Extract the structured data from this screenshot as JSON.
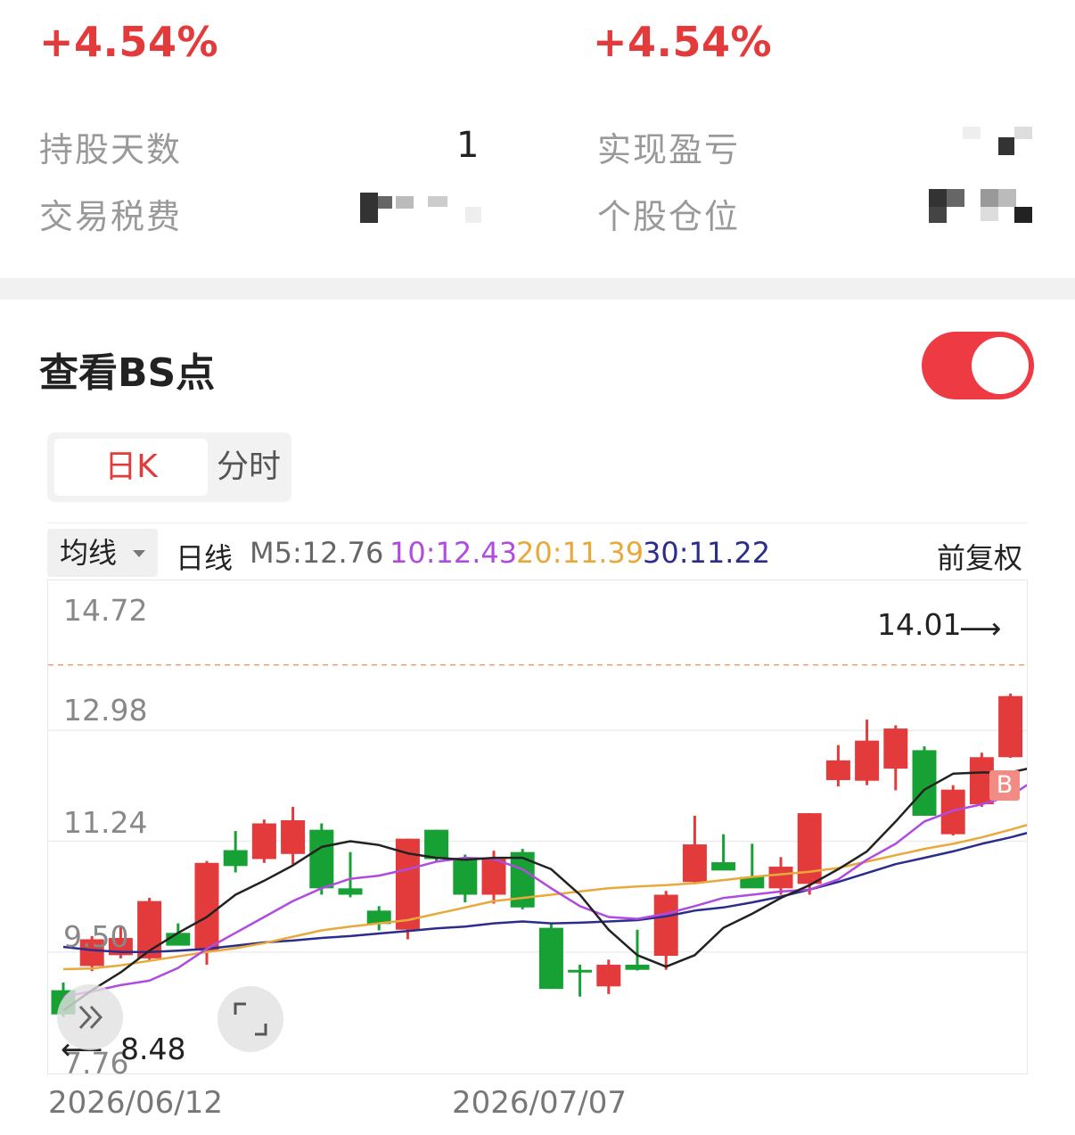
{
  "stats": {
    "pct_left": "+4.54%",
    "pct_right": "+4.54%",
    "hold_days_label": "持股天数",
    "hold_days_value": "1",
    "realized_pnl_label": "实现盈亏",
    "tax_fee_label": "交易税费",
    "position_label": "个股仓位"
  },
  "bs_section": {
    "title": "查看BS点",
    "toggle_on": true
  },
  "tabs": {
    "daily": "日K",
    "intraday": "分时"
  },
  "ma_bar": {
    "selector": "均线",
    "period": "日线",
    "m5": "M5:12.76",
    "m10": "10:12.43",
    "m20": "20:11.39",
    "m30": "30:11.22",
    "adjust": "前复权"
  },
  "colors": {
    "up": "#e33b3b",
    "down": "#17a135",
    "m5": "#222222",
    "m10": "#b04be0",
    "m20": "#e9a93a",
    "m30": "#2c2c8c"
  },
  "chart_data": {
    "type": "candlestick",
    "y_ticks": [
      "14.72",
      "12.98",
      "11.24",
      "9.50",
      "7.76"
    ],
    "ylim": [
      7.76,
      14.72
    ],
    "x_labels": [
      "2026/06/12",
      "2026/07/07"
    ],
    "max_label": "14.01",
    "min_label": "8.48",
    "buy_marker": "B",
    "candles": [
      {
        "o": 8.9,
        "h": 9.02,
        "l": 8.48,
        "c": 8.52
      },
      {
        "o": 9.28,
        "h": 9.75,
        "l": 9.2,
        "c": 9.7
      },
      {
        "o": 9.45,
        "h": 9.91,
        "l": 9.4,
        "c": 9.72
      },
      {
        "o": 9.4,
        "h": 10.35,
        "l": 9.38,
        "c": 10.3
      },
      {
        "o": 9.8,
        "h": 9.95,
        "l": 9.71,
        "c": 9.6
      },
      {
        "o": 9.52,
        "h": 10.93,
        "l": 9.3,
        "c": 10.9
      },
      {
        "o": 11.1,
        "h": 11.4,
        "l": 10.75,
        "c": 10.85
      },
      {
        "o": 10.96,
        "h": 11.58,
        "l": 10.9,
        "c": 11.52
      },
      {
        "o": 11.04,
        "h": 11.78,
        "l": 10.88,
        "c": 11.57
      },
      {
        "o": 11.42,
        "h": 11.52,
        "l": 10.4,
        "c": 10.5
      },
      {
        "o": 10.5,
        "h": 11.07,
        "l": 10.36,
        "c": 10.4
      },
      {
        "o": 10.15,
        "h": 10.22,
        "l": 9.84,
        "c": 9.94
      },
      {
        "o": 9.85,
        "h": 11.28,
        "l": 9.7,
        "c": 11.28
      },
      {
        "o": 11.42,
        "h": 11.42,
        "l": 10.92,
        "c": 10.96
      },
      {
        "o": 10.96,
        "h": 11.03,
        "l": 10.28,
        "c": 10.4
      },
      {
        "o": 10.4,
        "h": 11.09,
        "l": 10.26,
        "c": 10.96
      },
      {
        "o": 11.07,
        "h": 11.12,
        "l": 10.17,
        "c": 10.2
      },
      {
        "o": 9.88,
        "h": 9.94,
        "l": 8.92,
        "c": 8.92
      },
      {
        "o": 9.22,
        "h": 9.3,
        "l": 8.8,
        "c": 9.19
      },
      {
        "o": 8.96,
        "h": 9.38,
        "l": 8.84,
        "c": 9.3
      },
      {
        "o": 9.3,
        "h": 9.85,
        "l": 9.21,
        "c": 9.22
      },
      {
        "o": 9.44,
        "h": 10.46,
        "l": 9.22,
        "c": 10.4
      },
      {
        "o": 10.6,
        "h": 11.64,
        "l": 10.58,
        "c": 11.19
      },
      {
        "o": 10.91,
        "h": 11.35,
        "l": 10.8,
        "c": 10.78
      },
      {
        "o": 10.68,
        "h": 11.2,
        "l": 10.63,
        "c": 10.5
      },
      {
        "o": 10.5,
        "h": 10.99,
        "l": 10.4,
        "c": 10.84
      },
      {
        "o": 10.57,
        "h": 11.68,
        "l": 10.4,
        "c": 11.68
      },
      {
        "o": 12.2,
        "h": 12.75,
        "l": 12.1,
        "c": 12.51
      },
      {
        "o": 12.19,
        "h": 13.15,
        "l": 12.12,
        "c": 12.82
      },
      {
        "o": 12.38,
        "h": 13.06,
        "l": 12.04,
        "c": 13.01
      },
      {
        "o": 12.67,
        "h": 12.73,
        "l": 11.64,
        "c": 11.64
      },
      {
        "o": 11.35,
        "h": 12.12,
        "l": 11.33,
        "c": 12.05
      },
      {
        "o": 11.82,
        "h": 12.63,
        "l": 11.78,
        "c": 12.56
      },
      {
        "o": 12.56,
        "h": 13.56,
        "l": 12.55,
        "c": 13.52
      },
      {
        "o": 13.47,
        "h": 14.01,
        "l": 12.98,
        "c": 14.01
      }
    ],
    "ma5": [
      8.58,
      8.9,
      9.18,
      9.52,
      9.8,
      10.05,
      10.4,
      10.62,
      10.86,
      11.15,
      11.24,
      11.18,
      11.05,
      10.98,
      10.95,
      10.98,
      10.98,
      10.8,
      10.4,
      9.85,
      9.45,
      9.27,
      9.45,
      9.88,
      10.1,
      10.35,
      10.55,
      10.8,
      11.08,
      11.55,
      12.05,
      12.3,
      12.32,
      12.32,
      12.42,
      12.64
    ],
    "ma10": [
      8.8,
      8.88,
      8.98,
      9.05,
      9.25,
      9.55,
      9.8,
      10.05,
      10.3,
      10.5,
      10.65,
      10.7,
      10.8,
      10.92,
      10.98,
      10.96,
      10.8,
      10.5,
      10.22,
      10.05,
      10.02,
      10.1,
      10.22,
      10.35,
      10.4,
      10.45,
      10.48,
      10.64,
      10.95,
      11.2,
      11.55,
      11.72,
      11.82,
      11.95,
      12.25,
      12.44
    ],
    "ma20": [
      9.23,
      9.24,
      9.29,
      9.36,
      9.43,
      9.5,
      9.56,
      9.64,
      9.74,
      9.84,
      9.9,
      9.95,
      10.0,
      10.1,
      10.2,
      10.3,
      10.35,
      10.4,
      10.45,
      10.5,
      10.53,
      10.55,
      10.58,
      10.63,
      10.68,
      10.72,
      10.76,
      10.82,
      10.92,
      11.02,
      11.12,
      11.2,
      11.3,
      11.42,
      11.55,
      11.7
    ],
    "ma30": [
      9.58,
      9.53,
      9.5,
      9.5,
      9.52,
      9.55,
      9.6,
      9.65,
      9.68,
      9.72,
      9.75,
      9.79,
      9.83,
      9.87,
      9.9,
      9.95,
      9.98,
      9.95,
      9.96,
      9.98,
      10.0,
      10.06,
      10.15,
      10.2,
      10.28,
      10.37,
      10.48,
      10.6,
      10.74,
      10.88,
      10.98,
      11.08,
      11.2,
      11.3,
      11.42,
      11.55
    ]
  }
}
